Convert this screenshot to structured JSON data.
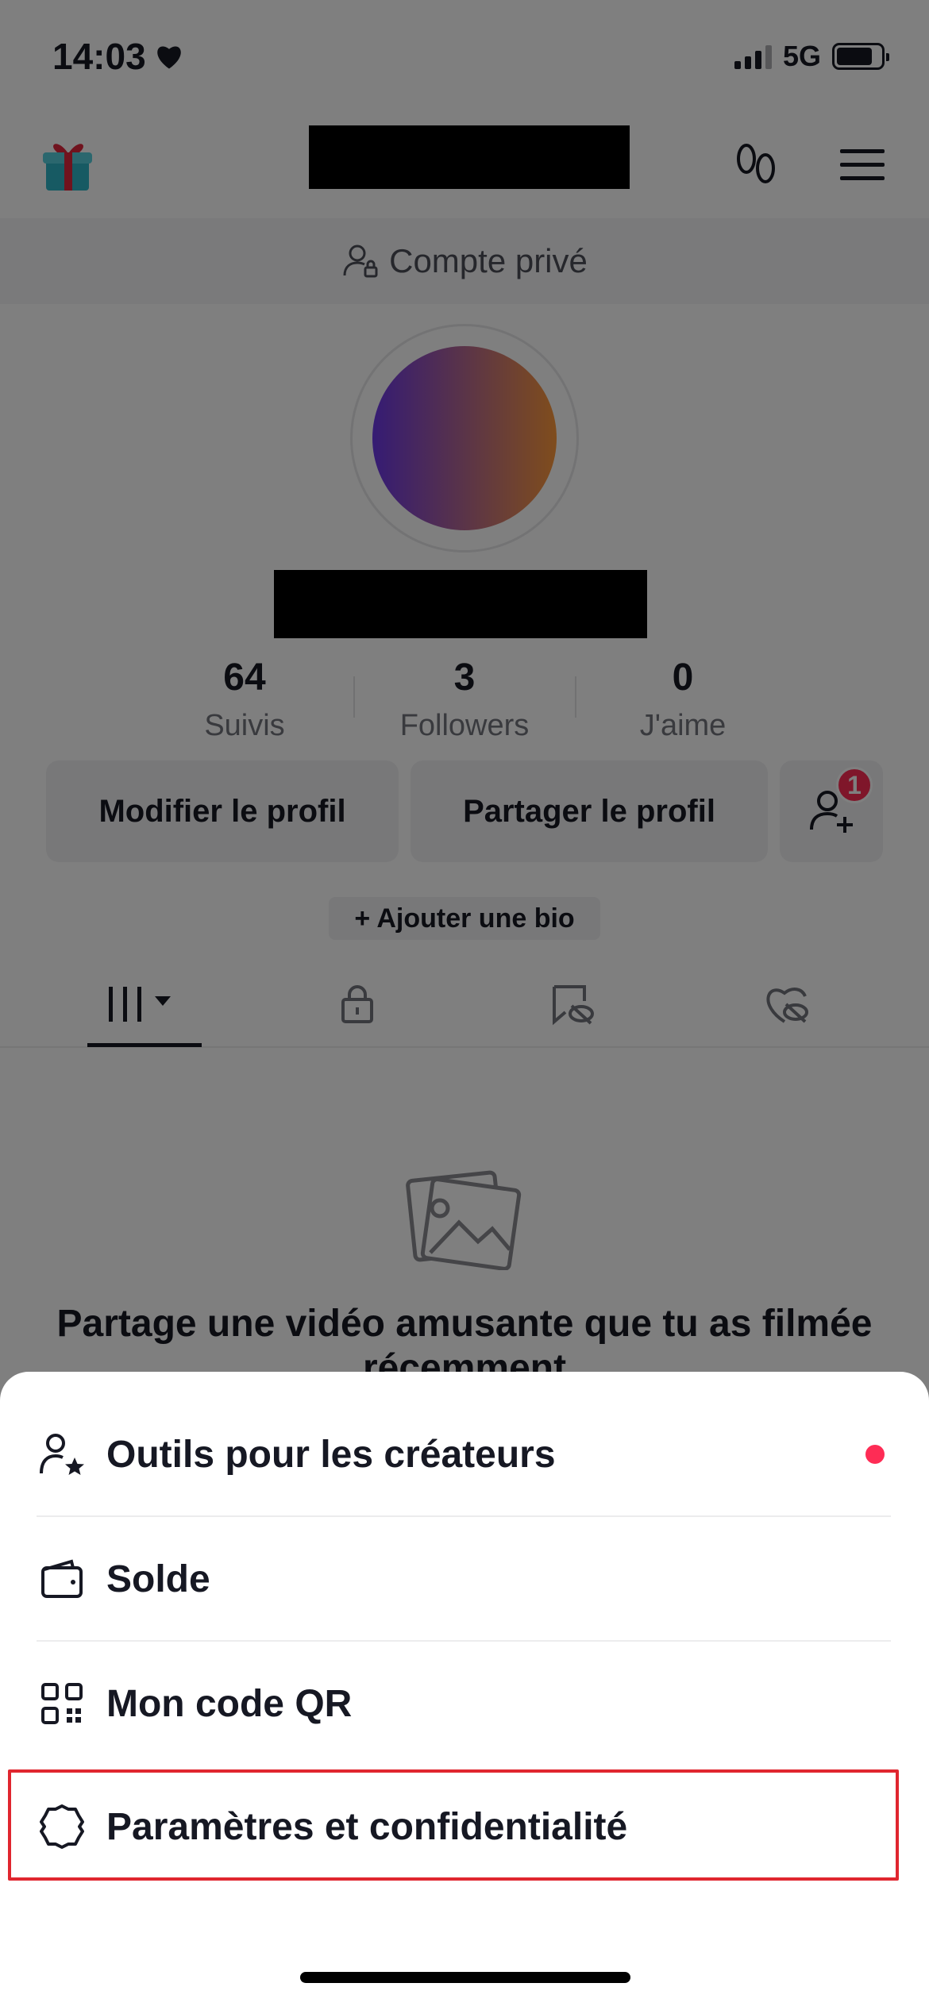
{
  "status_bar": {
    "time": "14:03",
    "network": "5G"
  },
  "profile": {
    "private_banner": "Compte privé",
    "stats": [
      {
        "value": "64",
        "label": "Suivis"
      },
      {
        "value": "3",
        "label": "Followers"
      },
      {
        "value": "0",
        "label": "J'aime"
      }
    ],
    "edit_button": "Modifier le profil",
    "share_button": "Partager le profil",
    "friend_badge": "1",
    "add_bio": "+ Ajouter une bio",
    "empty_state": "Partage une vidéo amusante que tu as filmée récemment"
  },
  "tabs": [
    {
      "icon": "grid-icon",
      "selected": true
    },
    {
      "icon": "lock-icon",
      "selected": false
    },
    {
      "icon": "bookmark-hidden-icon",
      "selected": false
    },
    {
      "icon": "heart-hidden-icon",
      "selected": false
    }
  ],
  "menu_sheet": {
    "items": [
      {
        "label": "Outils pour les créateurs",
        "icon": "creator-star-icon",
        "has_dot": true
      },
      {
        "label": "Solde",
        "icon": "wallet-icon",
        "has_dot": false
      },
      {
        "label": "Mon code QR",
        "icon": "qr-code-icon",
        "has_dot": false
      },
      {
        "label": "Paramètres et confidentialité",
        "icon": "settings-gear-icon",
        "has_dot": false,
        "highlighted": true
      }
    ]
  },
  "colors": {
    "accent": "#fe2c55",
    "highlight": "#e0262f",
    "text": "#161823",
    "muted": "#73757d"
  }
}
